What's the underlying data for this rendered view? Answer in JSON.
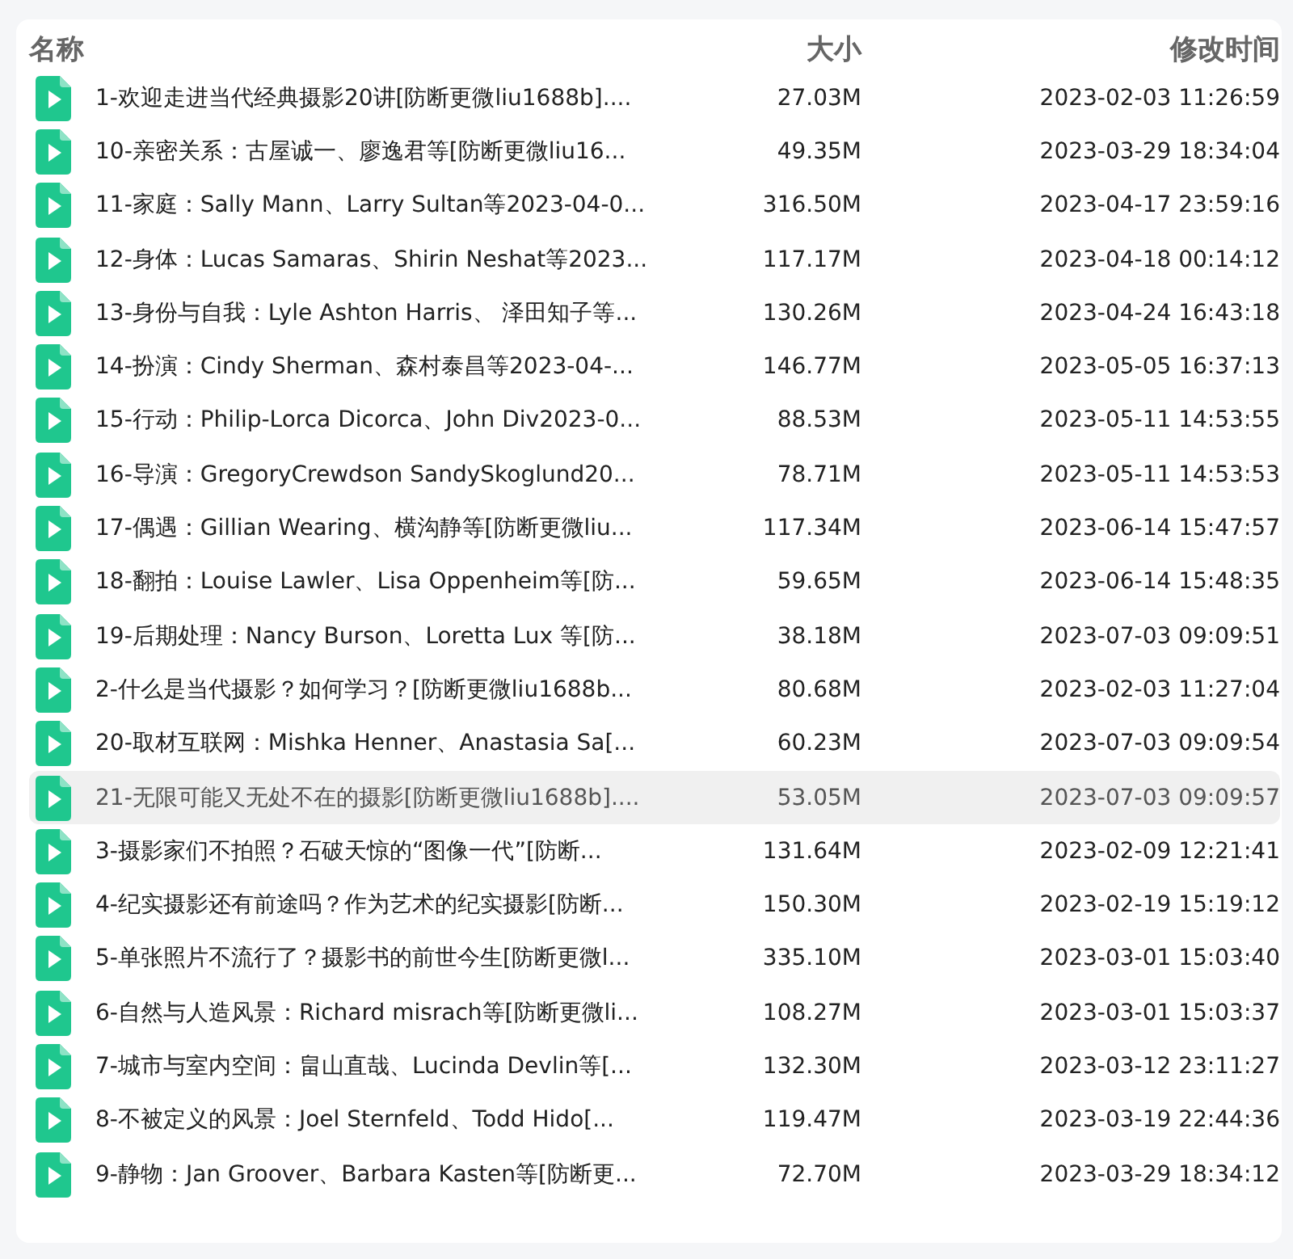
{
  "columns": [
    {
      "label": "名称"
    },
    {
      "label": "大小"
    },
    {
      "label": "修改时间"
    }
  ],
  "rows": [
    {
      "name": "1-欢迎走进当代经典摄影20讲[防断更微liu1688b]....",
      "size": "27.03M",
      "modified": "2023-02-03 11:26:59",
      "highlighted": false
    },
    {
      "name": "10-亲密关系：古屋诚一、廖逸君等[防断更微liu16...",
      "size": "49.35M",
      "modified": "2023-03-29 18:34:04",
      "highlighted": false
    },
    {
      "name": "11-家庭：Sally Mann、Larry Sultan等2023-04-0...",
      "size": "316.50M",
      "modified": "2023-04-17 23:59:16",
      "highlighted": false
    },
    {
      "name": "12-身体：Lucas Samaras、Shirin Neshat等2023...",
      "size": "117.17M",
      "modified": "2023-04-18 00:14:12",
      "highlighted": false
    },
    {
      "name": "13-身份与自我：Lyle Ashton Harris、 泽田知子等...",
      "size": "130.26M",
      "modified": "2023-04-24 16:43:18",
      "highlighted": false
    },
    {
      "name": "14-扮演：Cindy Sherman、森村泰昌等2023-04-...",
      "size": "146.77M",
      "modified": "2023-05-05 16:37:13",
      "highlighted": false
    },
    {
      "name": "15-行动：Philip-Lorca Dicorca、John Div2023-0...",
      "size": "88.53M",
      "modified": "2023-05-11 14:53:55",
      "highlighted": false
    },
    {
      "name": "16-导演：GregoryCrewdson SandySkoglund20...",
      "size": "78.71M",
      "modified": "2023-05-11 14:53:53",
      "highlighted": false
    },
    {
      "name": "17-偶遇：Gillian Wearing、横沟静等[防断更微liu...",
      "size": "117.34M",
      "modified": "2023-06-14 15:47:57",
      "highlighted": false
    },
    {
      "name": "18-翻拍：Louise Lawler、Lisa Oppenheim等[防...",
      "size": "59.65M",
      "modified": "2023-06-14 15:48:35",
      "highlighted": false
    },
    {
      "name": "19-后期处理：Nancy Burson、Loretta Lux 等[防...",
      "size": "38.18M",
      "modified": "2023-07-03 09:09:51",
      "highlighted": false
    },
    {
      "name": "2-什么是当代摄影？如何学习？[防断更微liu1688b...",
      "size": "80.68M",
      "modified": "2023-02-03 11:27:04",
      "highlighted": false
    },
    {
      "name": "20-取材互联网：Mishka Henner、Anastasia Sa[...",
      "size": "60.23M",
      "modified": "2023-07-03 09:09:54",
      "highlighted": false
    },
    {
      "name": "21-无限可能又无处不在的摄影[防断更微liu1688b]....",
      "size": "53.05M",
      "modified": "2023-07-03 09:09:57",
      "highlighted": true
    },
    {
      "name": "3-摄影家们不拍照？石破天惊的“图像一代”[防断...",
      "size": "131.64M",
      "modified": "2023-02-09 12:21:41",
      "highlighted": false
    },
    {
      "name": "4-纪实摄影还有前途吗？作为艺术的纪实摄影[防断...",
      "size": "150.30M",
      "modified": "2023-02-19 15:19:12",
      "highlighted": false
    },
    {
      "name": "5-单张照片不流行了？摄影书的前世今生[防断更微l...",
      "size": "335.10M",
      "modified": "2023-03-01 15:03:40",
      "highlighted": false
    },
    {
      "name": "6-自然与人造风景：Richard misrach等[防断更微li...",
      "size": "108.27M",
      "modified": "2023-03-01 15:03:37",
      "highlighted": false
    },
    {
      "name": "7-城市与室内空间：畠山直哉、Lucinda Devlin等[...",
      "size": "132.30M",
      "modified": "2023-03-12 23:11:27",
      "highlighted": false
    },
    {
      "name": "8-不被定义的风景：Joel Sternfeld、Todd Hido[...",
      "size": "119.47M",
      "modified": "2023-03-19 22:44:36",
      "highlighted": false
    },
    {
      "name": "9-静物：Jan Groover、Barbara Kasten等[防断更...",
      "size": "72.70M",
      "modified": "2023-03-29 18:34:12",
      "highlighted": false
    }
  ]
}
